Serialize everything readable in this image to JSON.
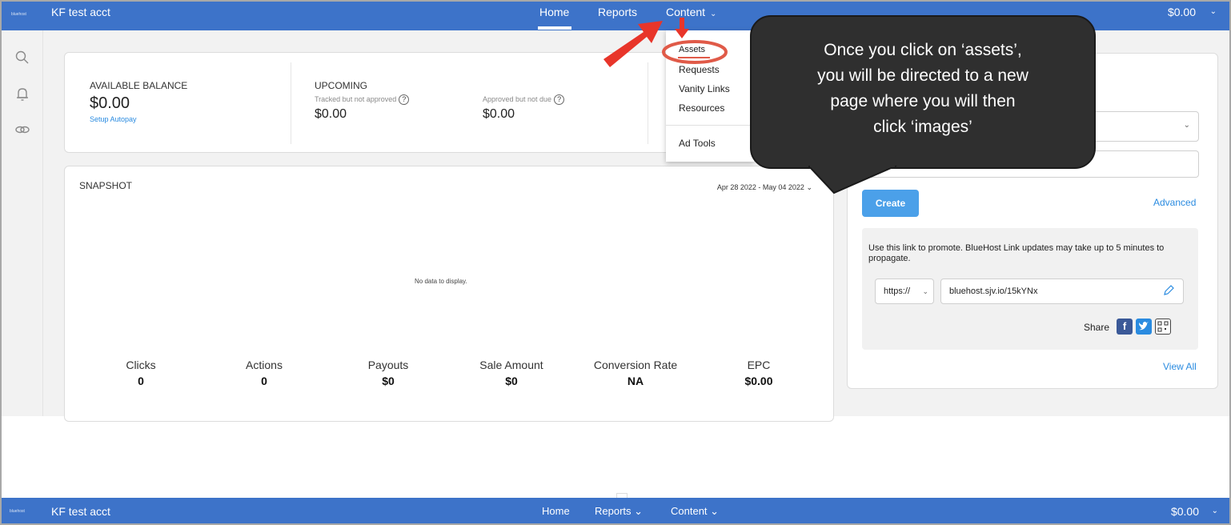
{
  "colors": {
    "nav_bg": "#3d73c9",
    "accent": "#4ba0e9",
    "link": "#2a8be0",
    "callout_bg": "#2f2f2f",
    "arrow": "#e8352a",
    "highlight_ring": "#e05a48"
  },
  "topbar": {
    "logo": "bluehost",
    "account_name": "KF test acct",
    "nav": {
      "home": "Home",
      "reports": "Reports",
      "content": "Content"
    },
    "balance": "$0.00",
    "chevron": "⌄"
  },
  "sidebar": {
    "icons": [
      "search-icon",
      "bell-icon",
      "link-icon"
    ]
  },
  "balance_card": {
    "available_label": "AVAILABLE BALANCE",
    "available_value": "$0.00",
    "setup_autopay": "Setup Autopay",
    "upcoming_label": "UPCOMING",
    "tracked_label": "Tracked but not approved",
    "tracked_value": "$0.00",
    "approved_label": "Approved but not due",
    "approved_value": "$0.00",
    "help": "?"
  },
  "content_dropdown": {
    "items": [
      "Assets",
      "Requests",
      "Vanity Links",
      "Resources",
      "Ad Tools"
    ]
  },
  "snapshot": {
    "title": "SNAPSHOT",
    "date_range": "Apr 28 2022 - May 04 2022",
    "empty": "No data to display.",
    "metrics": [
      {
        "label": "Clicks",
        "value": "0"
      },
      {
        "label": "Actions",
        "value": "0"
      },
      {
        "label": "Payouts",
        "value": "$0"
      },
      {
        "label": "Sale Amount",
        "value": "$0"
      },
      {
        "label": "Conversion Rate",
        "value": "NA"
      },
      {
        "label": "EPC",
        "value": "$0.00"
      }
    ]
  },
  "callout": {
    "lines": [
      "Once you click on ‘assets’,",
      "you will be directed to a new",
      "page where you will then",
      "click ‘images’"
    ]
  },
  "link_panel": {
    "create": "Create",
    "advanced": "Advanced",
    "promo_text": "Use this link to promote. BlueHost Link updates may take up to 5 minutes to propagate.",
    "protocol": "https://",
    "link": "bluehost.sjv.io/15kYNx",
    "share": "Share",
    "view_all": "View All"
  },
  "bottombar": {
    "logo": "bluehost",
    "account_name": "KF test acct",
    "nav": {
      "home": "Home",
      "reports": "Reports",
      "content": "Content"
    },
    "balance": "$0.00"
  }
}
